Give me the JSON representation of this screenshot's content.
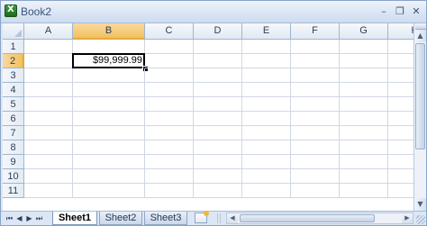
{
  "window": {
    "title": "Book2",
    "minimize_glyph": "–",
    "restore_glyph": "❐",
    "close_glyph": "✕"
  },
  "sheet": {
    "columns": [
      "A",
      "B",
      "C",
      "D",
      "E",
      "F",
      "G",
      "H"
    ],
    "rows": [
      "1",
      "2",
      "3",
      "4",
      "5",
      "6",
      "7",
      "8",
      "9",
      "10",
      "11"
    ],
    "active_cell": "B2",
    "cells": [
      {
        "ref": "B2",
        "value": "$99,999.99"
      }
    ]
  },
  "tabs": {
    "nav": [
      "⏮",
      "◀",
      "▶",
      "⏭"
    ],
    "sheets": [
      "Sheet1",
      "Sheet2",
      "Sheet3"
    ],
    "active": "Sheet1",
    "new_sheet_icon": "insert-worksheet-icon"
  },
  "colors": {
    "selected_header": "#f1c15f",
    "gridline": "#d0d7e5",
    "header_border": "#9eb6ce",
    "frame": "#dce6f4"
  }
}
